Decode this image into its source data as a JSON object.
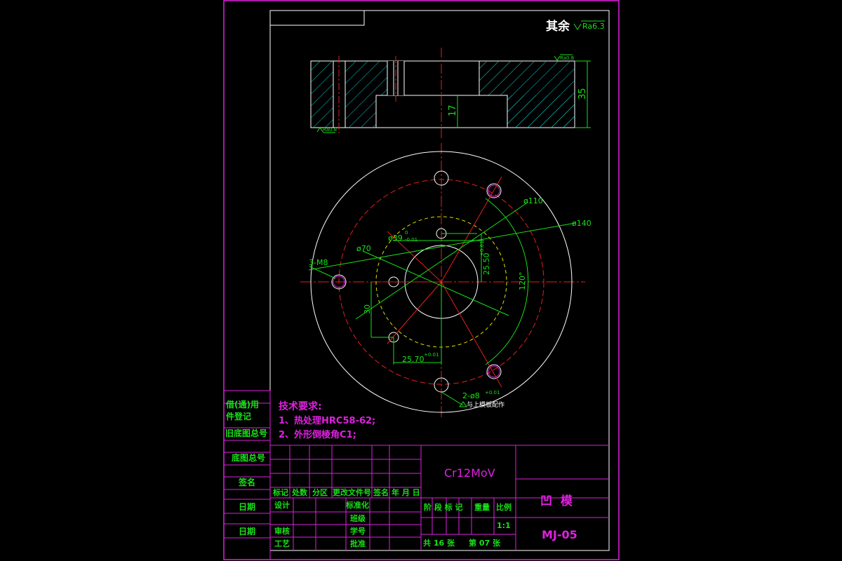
{
  "surface_note": {
    "prefix": "其余",
    "roughness": "Ra6.3"
  },
  "section_view": {
    "top_roughness": "Ra0.8",
    "bottom_roughness": "Ra0.8",
    "dim_height": "35",
    "dim_recess": "17"
  },
  "plan_view": {
    "dim_d110": "ø110",
    "dim_d140": "ø140",
    "dim_d70": "ø70",
    "dim_d39": "ø39",
    "dim_d39_tol_upper": "0",
    "dim_d39_tol_lower": "-0.01",
    "dim_thread": "3-M8",
    "dim_2550": "25.50",
    "dim_2550_tol": "+0.01",
    "dim_angle": "120°",
    "dim_30": "30",
    "dim_2570": "25.70",
    "dim_2570_tol": "+0.01",
    "dim_pin": "2-ø8",
    "dim_pin_tol": "+0.01",
    "dim_pin_note": "与上模板配作"
  },
  "tech_requirements": {
    "title": "技术要求:",
    "item1": "1、热处理HRC58-62;",
    "item2": "2、外形倒棱角C1;"
  },
  "left_strip": {
    "row1": "借(通)用",
    "row2": "件登记",
    "row3": "旧底图总号",
    "row4": "底图总号",
    "row5": "签名",
    "row6": "日期",
    "row7": "日期"
  },
  "title_block": {
    "material": "Cr12MoV",
    "part_name": "凹  模",
    "drawing_no": "MJ-05",
    "h_mark": "标记",
    "h_count": "处数",
    "h_zone": "分区",
    "h_docno": "更改文件号",
    "h_sign": "签名",
    "h_date": "年 月 日",
    "design": "设计",
    "standardize": "标准化",
    "check": "审核",
    "process": "工艺",
    "class": "班级",
    "student_no": "学号",
    "approve": "批准",
    "h_stage": "阶 段 标 记",
    "h_weight": "重量",
    "h_scale": "比例",
    "scale": "1:1",
    "sheets_total": "共 16 张",
    "sheet_no": "第 07 张"
  },
  "colors": {
    "border": "#e020e0",
    "outline": "#ffffff",
    "dimension": "#18e018",
    "centerline": "#e02020",
    "hatch": "#18d0d0",
    "hidden": "#e0e000"
  }
}
